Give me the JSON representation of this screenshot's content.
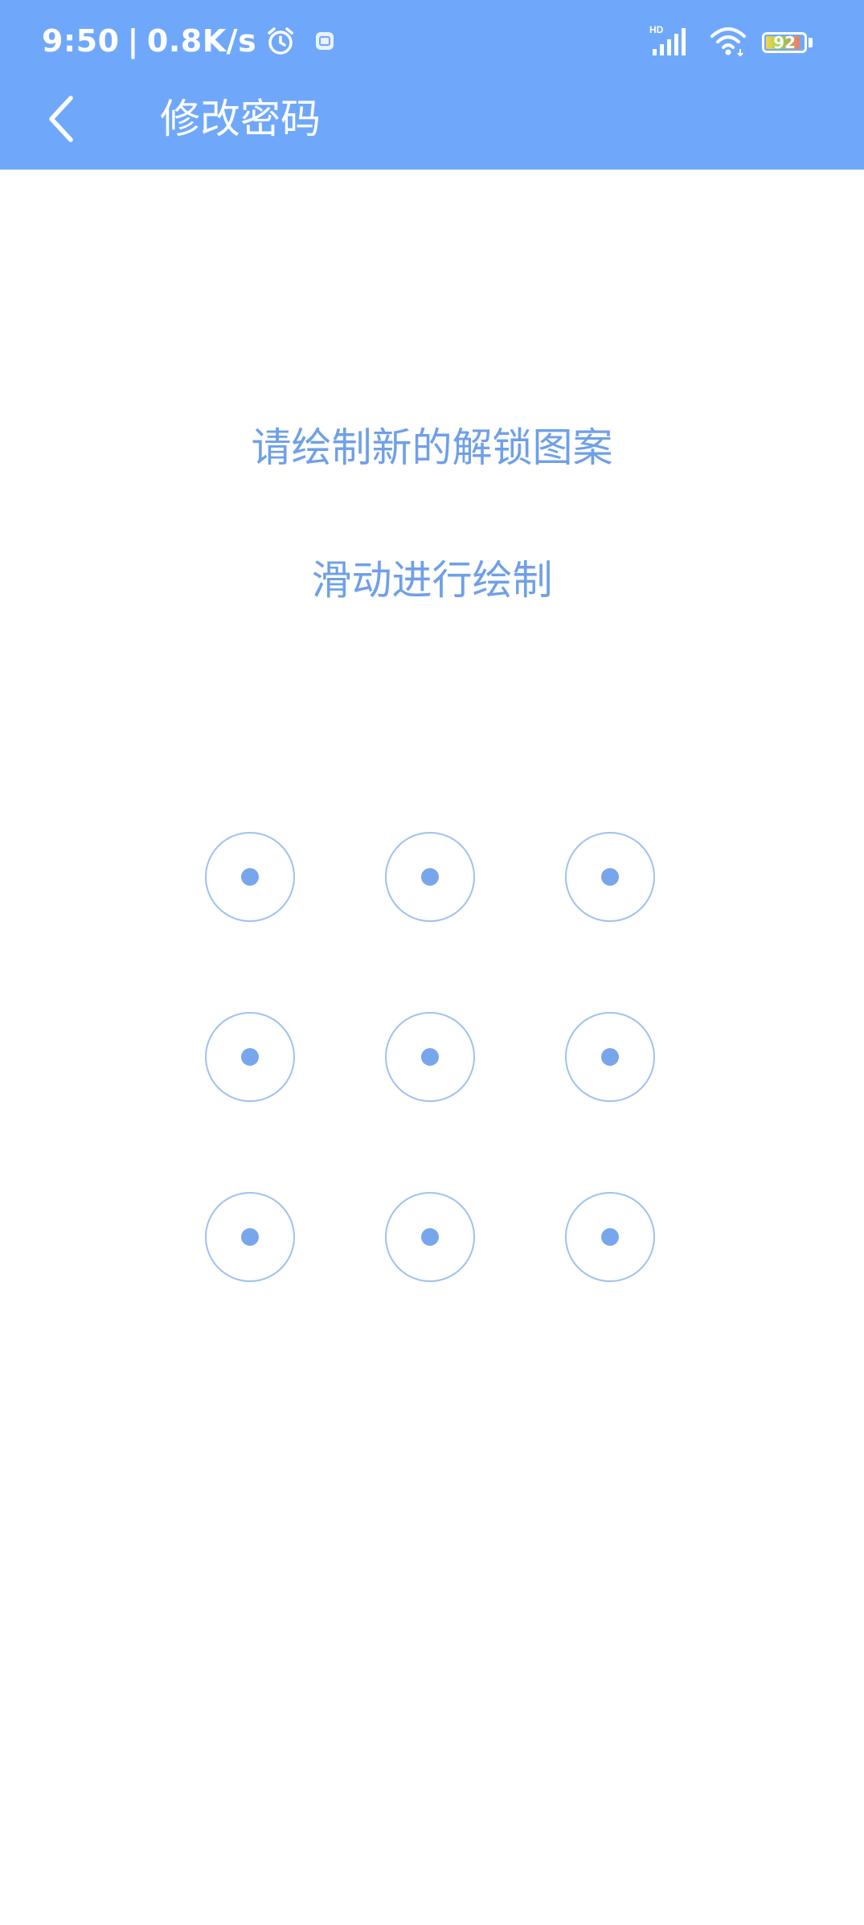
{
  "status_bar": {
    "time": "9:50",
    "separator": "|",
    "network_speed": "0.8K/s",
    "signal_label": "HD",
    "battery_level": "92",
    "icons": {
      "alarm": "alarm-clock-icon",
      "notification": "app-notification-icon",
      "signal": "cellular-signal-icon",
      "wifi": "wifi-icon",
      "battery": "battery-icon"
    }
  },
  "nav": {
    "back_icon": "chevron-left-icon",
    "title": "修改密码"
  },
  "content": {
    "instruction": "请绘制新的解锁图案",
    "hint": "滑动进行绘制"
  },
  "pattern": {
    "rows": 3,
    "columns": 3,
    "nodes": [
      1,
      2,
      3,
      4,
      5,
      6,
      7,
      8,
      9
    ]
  },
  "colors": {
    "header_background": "#6fa8fb",
    "text_accent": "#6fa0e8",
    "node_ring": "#9fc2ef",
    "node_dot": "#78a6ed",
    "background": "#ffffff"
  }
}
